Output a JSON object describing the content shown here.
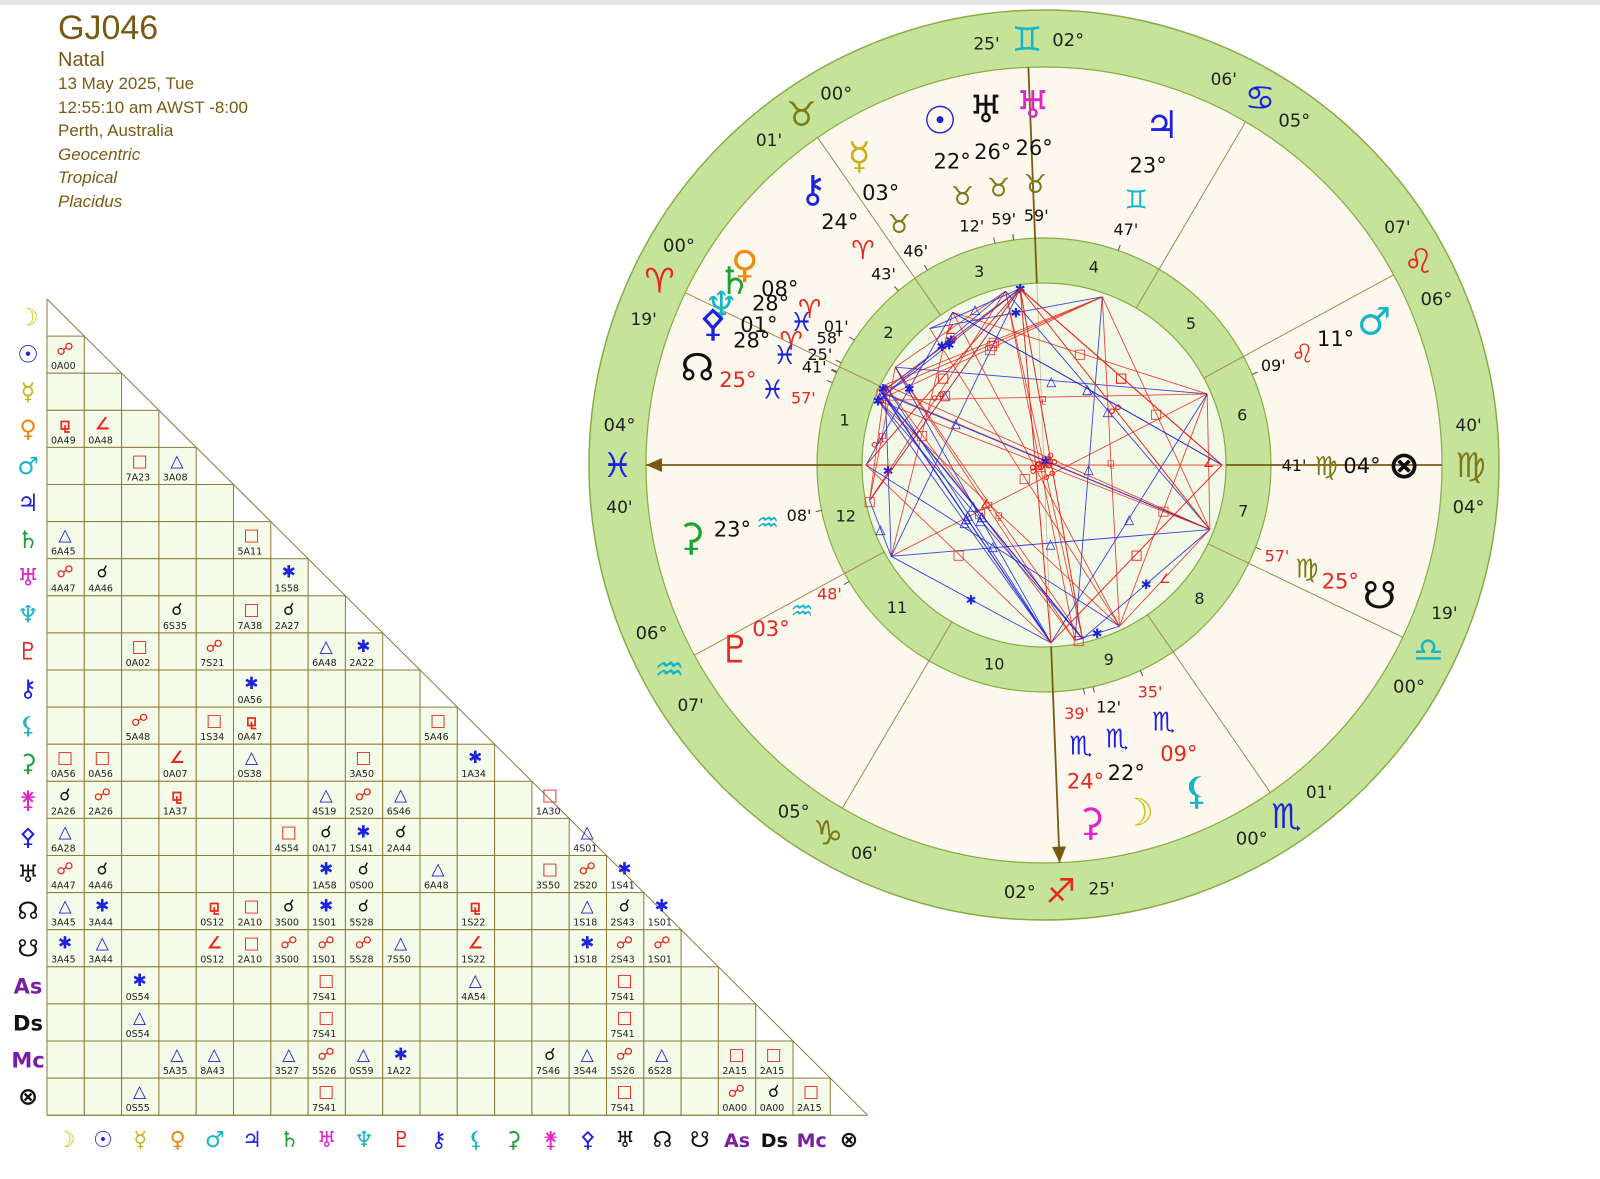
{
  "chart_info": {
    "name": "GJ046",
    "chart_type": "Natal",
    "date": "13 May 2025, Tue",
    "time": "12:55:10 am AWST -8:00",
    "place": "Perth, Australia",
    "zodiac_center": "Geocentric",
    "zodiac_type": "Tropical",
    "house_system": "Placidus"
  },
  "colors": {
    "wheel_ring": "#c5e49a",
    "wheel_ring_stroke": "#8aaa45",
    "chart_fill": "#fdf8ee",
    "inner_fill": "#f2f9e6",
    "grid_fill": "#f4fbe8",
    "grid_stroke": "#8b7a3a",
    "red": "#e8271e",
    "blue": "#1c22dd",
    "black": "#111111",
    "brown": "#7a5a12"
  },
  "grid_bodies": [
    {
      "glyph": "☽",
      "name": "Moon",
      "color": "#cfc217"
    },
    {
      "glyph": "☉",
      "name": "Sun",
      "color": "#1c22dd"
    },
    {
      "glyph": "☿",
      "name": "Mercury",
      "color": "#c9b11a"
    },
    {
      "glyph": "♀",
      "name": "Venus",
      "color": "#ee8a12"
    },
    {
      "glyph": "♂",
      "name": "Mars",
      "color": "#18b4c8"
    },
    {
      "glyph": "♃",
      "name": "Jupiter",
      "color": "#1c22dd"
    },
    {
      "glyph": "♄",
      "name": "Saturn",
      "color": "#1aa334"
    },
    {
      "glyph": "♅",
      "name": "Uranus",
      "color": "#e223c9"
    },
    {
      "glyph": "♆",
      "name": "Neptune",
      "color": "#18b4c8"
    },
    {
      "glyph": "♇",
      "name": "Pluto",
      "color": "#e8271e"
    },
    {
      "glyph": "⚷",
      "name": "Chiron",
      "color": "#1c22dd"
    },
    {
      "glyph": "⚸",
      "name": "Lilith",
      "color": "#18b4c8"
    },
    {
      "glyph": "⚳",
      "name": "Ceres",
      "color": "#1aa334"
    },
    {
      "glyph": "⚵",
      "name": "Juno",
      "color": "#e223c9"
    },
    {
      "glyph": "⚴",
      "name": "Pallas",
      "color": "#1c22dd"
    },
    {
      "glyph": "♅",
      "name": "Vertex",
      "color": "#111111"
    },
    {
      "glyph": "☊",
      "name": "North Node",
      "color": "#111111"
    },
    {
      "glyph": "☋",
      "name": "South Node",
      "color": "#111111"
    },
    {
      "glyph": "As",
      "name": "Ascendant",
      "color": "#7b1fa2"
    },
    {
      "glyph": "Ds",
      "name": "Descendant",
      "color": "#111111"
    },
    {
      "glyph": "Mc",
      "name": "Midheaven",
      "color": "#7b1fa2"
    },
    {
      "glyph": "⊗",
      "name": "Part of Fortune",
      "color": "#111111"
    }
  ],
  "aspects": [
    {
      "r": 1,
      "c": 0,
      "g": "☍",
      "t": "0A00",
      "k": "red"
    },
    {
      "r": 3,
      "c": 0,
      "g": "⚼",
      "t": "0A49",
      "k": "red"
    },
    {
      "r": 3,
      "c": 1,
      "g": "∠",
      "t": "0A48",
      "k": "red"
    },
    {
      "r": 4,
      "c": 2,
      "g": "□",
      "t": "7A23",
      "k": "red"
    },
    {
      "r": 4,
      "c": 3,
      "g": "△",
      "t": "3A08",
      "k": "blue"
    },
    {
      "r": 6,
      "c": 0,
      "g": "△",
      "t": "6A45",
      "k": "blue"
    },
    {
      "r": 6,
      "c": 5,
      "g": "□",
      "t": "5A11",
      "k": "red"
    },
    {
      "r": 7,
      "c": 0,
      "g": "☍",
      "t": "4A47",
      "k": "red"
    },
    {
      "r": 7,
      "c": 1,
      "g": "☌",
      "t": "4A46",
      "k": "black"
    },
    {
      "r": 7,
      "c": 6,
      "g": "✱",
      "t": "1S58",
      "k": "blue"
    },
    {
      "r": 8,
      "c": 3,
      "g": "☌",
      "t": "6S35",
      "k": "black"
    },
    {
      "r": 8,
      "c": 5,
      "g": "□",
      "t": "7A38",
      "k": "red"
    },
    {
      "r": 8,
      "c": 6,
      "g": "☌",
      "t": "2A27",
      "k": "black"
    },
    {
      "r": 9,
      "c": 2,
      "g": "□",
      "t": "0A02",
      "k": "red"
    },
    {
      "r": 9,
      "c": 4,
      "g": "☍",
      "t": "7S21",
      "k": "red"
    },
    {
      "r": 9,
      "c": 7,
      "g": "△",
      "t": "6A48",
      "k": "blue"
    },
    {
      "r": 9,
      "c": 8,
      "g": "✱",
      "t": "2A22",
      "k": "blue"
    },
    {
      "r": 10,
      "c": 5,
      "g": "✱",
      "t": "0A56",
      "k": "blue"
    },
    {
      "r": 11,
      "c": 2,
      "g": "☍",
      "t": "5A48",
      "k": "red"
    },
    {
      "r": 11,
      "c": 4,
      "g": "□",
      "t": "1S34",
      "k": "red"
    },
    {
      "r": 11,
      "c": 5,
      "g": "⚼",
      "t": "0A47",
      "k": "red"
    },
    {
      "r": 11,
      "c": 10,
      "g": "□",
      "t": "5A46",
      "k": "red"
    },
    {
      "r": 12,
      "c": 0,
      "g": "□",
      "t": "0A56",
      "k": "red"
    },
    {
      "r": 12,
      "c": 1,
      "g": "□",
      "t": "0A56",
      "k": "red"
    },
    {
      "r": 12,
      "c": 3,
      "g": "∠",
      "t": "0A07",
      "k": "red"
    },
    {
      "r": 12,
      "c": 5,
      "g": "△",
      "t": "0S38",
      "k": "blue"
    },
    {
      "r": 12,
      "c": 8,
      "g": "□",
      "t": "3A50",
      "k": "red"
    },
    {
      "r": 12,
      "c": 11,
      "g": "✱",
      "t": "1A34",
      "k": "blue"
    },
    {
      "r": 13,
      "c": 0,
      "g": "☌",
      "t": "2A26",
      "k": "black"
    },
    {
      "r": 13,
      "c": 1,
      "g": "☍",
      "t": "2A26",
      "k": "red"
    },
    {
      "r": 13,
      "c": 3,
      "g": "⚼",
      "t": "1A37",
      "k": "red"
    },
    {
      "r": 13,
      "c": 7,
      "g": "△",
      "t": "4S19",
      "k": "blue"
    },
    {
      "r": 13,
      "c": 8,
      "g": "☍",
      "t": "2S20",
      "k": "red"
    },
    {
      "r": 13,
      "c": 9,
      "g": "△",
      "t": "6S46",
      "k": "blue"
    },
    {
      "r": 13,
      "c": 13,
      "g": "□",
      "t": "1A30",
      "k": "red"
    },
    {
      "r": 14,
      "c": 0,
      "g": "△",
      "t": "6A28",
      "k": "blue"
    },
    {
      "r": 14,
      "c": 6,
      "g": "□",
      "t": "4S54",
      "k": "red"
    },
    {
      "r": 14,
      "c": 7,
      "g": "☌",
      "t": "0A17",
      "k": "black"
    },
    {
      "r": 14,
      "c": 8,
      "g": "✱",
      "t": "1S41",
      "k": "blue"
    },
    {
      "r": 14,
      "c": 9,
      "g": "☌",
      "t": "2A44",
      "k": "black"
    },
    {
      "r": 14,
      "c": 14,
      "g": "△",
      "t": "4S01",
      "k": "blue"
    },
    {
      "r": 15,
      "c": 0,
      "g": "☍",
      "t": "4A47",
      "k": "red"
    },
    {
      "r": 15,
      "c": 1,
      "g": "☌",
      "t": "4A46",
      "k": "black"
    },
    {
      "r": 15,
      "c": 7,
      "g": "✱",
      "t": "1A58",
      "k": "blue"
    },
    {
      "r": 15,
      "c": 8,
      "g": "☌",
      "t": "0S00",
      "k": "black"
    },
    {
      "r": 15,
      "c": 10,
      "g": "△",
      "t": "6A48",
      "k": "blue"
    },
    {
      "r": 15,
      "c": 13,
      "g": "□",
      "t": "3S50",
      "k": "red"
    },
    {
      "r": 15,
      "c": 14,
      "g": "☍",
      "t": "2S20",
      "k": "red"
    },
    {
      "r": 15,
      "c": 15,
      "g": "✱",
      "t": "1S41",
      "k": "blue"
    },
    {
      "r": 16,
      "c": 0,
      "g": "△",
      "t": "3A45",
      "k": "blue"
    },
    {
      "r": 16,
      "c": 1,
      "g": "✱",
      "t": "3A44",
      "k": "blue"
    },
    {
      "r": 16,
      "c": 4,
      "g": "⚼",
      "t": "0S12",
      "k": "red"
    },
    {
      "r": 16,
      "c": 5,
      "g": "□",
      "t": "2A10",
      "k": "red"
    },
    {
      "r": 16,
      "c": 6,
      "g": "☌",
      "t": "3S00",
      "k": "black"
    },
    {
      "r": 16,
      "c": 7,
      "g": "✱",
      "t": "1S01",
      "k": "blue"
    },
    {
      "r": 16,
      "c": 8,
      "g": "☌",
      "t": "5S28",
      "k": "black"
    },
    {
      "r": 16,
      "c": 11,
      "g": "⚼",
      "t": "1S22",
      "k": "red"
    },
    {
      "r": 16,
      "c": 14,
      "g": "△",
      "t": "1S18",
      "k": "blue"
    },
    {
      "r": 16,
      "c": 15,
      "g": "☌",
      "t": "2S43",
      "k": "black"
    },
    {
      "r": 16,
      "c": 16,
      "g": "✱",
      "t": "1S01",
      "k": "blue"
    },
    {
      "r": 17,
      "c": 0,
      "g": "✱",
      "t": "3A45",
      "k": "blue"
    },
    {
      "r": 17,
      "c": 1,
      "g": "△",
      "t": "3A44",
      "k": "blue"
    },
    {
      "r": 17,
      "c": 4,
      "g": "∠",
      "t": "0S12",
      "k": "red"
    },
    {
      "r": 17,
      "c": 5,
      "g": "□",
      "t": "2A10",
      "k": "red"
    },
    {
      "r": 17,
      "c": 6,
      "g": "☍",
      "t": "3S00",
      "k": "red"
    },
    {
      "r": 17,
      "c": 7,
      "g": "☍",
      "t": "1S01",
      "k": "red"
    },
    {
      "r": 17,
      "c": 8,
      "g": "☍",
      "t": "5S28",
      "k": "red"
    },
    {
      "r": 17,
      "c": 9,
      "g": "△",
      "t": "7S50",
      "k": "blue"
    },
    {
      "r": 17,
      "c": 11,
      "g": "∠",
      "t": "1S22",
      "k": "red"
    },
    {
      "r": 17,
      "c": 14,
      "g": "✱",
      "t": "1S18",
      "k": "blue"
    },
    {
      "r": 17,
      "c": 15,
      "g": "☍",
      "t": "2S43",
      "k": "red"
    },
    {
      "r": 17,
      "c": 16,
      "g": "☍",
      "t": "1S01",
      "k": "red"
    },
    {
      "r": 18,
      "c": 2,
      "g": "✱",
      "t": "0S54",
      "k": "blue"
    },
    {
      "r": 18,
      "c": 7,
      "g": "□",
      "t": "7S41",
      "k": "red"
    },
    {
      "r": 18,
      "c": 11,
      "g": "△",
      "t": "4A54",
      "k": "blue"
    },
    {
      "r": 18,
      "c": 15,
      "g": "□",
      "t": "7S41",
      "k": "red"
    },
    {
      "r": 19,
      "c": 2,
      "g": "△",
      "t": "0S54",
      "k": "blue"
    },
    {
      "r": 19,
      "c": 7,
      "g": "□",
      "t": "7S41",
      "k": "red"
    },
    {
      "r": 19,
      "c": 15,
      "g": "□",
      "t": "7S41",
      "k": "red"
    },
    {
      "r": 20,
      "c": 3,
      "g": "△",
      "t": "5A35",
      "k": "blue"
    },
    {
      "r": 20,
      "c": 4,
      "g": "△",
      "t": "8A43",
      "k": "blue"
    },
    {
      "r": 20,
      "c": 6,
      "g": "△",
      "t": "3S27",
      "k": "blue"
    },
    {
      "r": 20,
      "c": 7,
      "g": "☍",
      "t": "5S26",
      "k": "red"
    },
    {
      "r": 20,
      "c": 8,
      "g": "△",
      "t": "0S59",
      "k": "blue"
    },
    {
      "r": 20,
      "c": 9,
      "g": "✱",
      "t": "1A22",
      "k": "blue"
    },
    {
      "r": 20,
      "c": 13,
      "g": "☌",
      "t": "7S46",
      "k": "black"
    },
    {
      "r": 20,
      "c": 14,
      "g": "△",
      "t": "3S44",
      "k": "blue"
    },
    {
      "r": 20,
      "c": 15,
      "g": "☍",
      "t": "5S26",
      "k": "red"
    },
    {
      "r": 20,
      "c": 16,
      "g": "△",
      "t": "6S28",
      "k": "blue"
    },
    {
      "r": 20,
      "c": 18,
      "g": "□",
      "t": "2A15",
      "k": "red"
    },
    {
      "r": 20,
      "c": 19,
      "g": "□",
      "t": "2A15",
      "k": "red"
    },
    {
      "r": 21,
      "c": 2,
      "g": "△",
      "t": "0S55",
      "k": "blue"
    },
    {
      "r": 21,
      "c": 7,
      "g": "□",
      "t": "7S41",
      "k": "red"
    },
    {
      "r": 21,
      "c": 15,
      "g": "□",
      "t": "7S41",
      "k": "red"
    },
    {
      "r": 21,
      "c": 18,
      "g": "☍",
      "t": "0A00",
      "k": "red"
    },
    {
      "r": 21,
      "c": 19,
      "g": "☌",
      "t": "0A00",
      "k": "black"
    },
    {
      "r": 21,
      "c": 20,
      "g": "□",
      "t": "2A15",
      "k": "red"
    }
  ],
  "wheel": {
    "asc_longitude": 334.67,
    "cusps": [
      {
        "house": 1,
        "lon": 334.67
      },
      {
        "house": 2,
        "lon": 0.32
      },
      {
        "house": 3,
        "lon": 30.02
      },
      {
        "house": 4,
        "lon": 62.42
      },
      {
        "house": 5,
        "lon": 95.1
      },
      {
        "house": 6,
        "lon": 126.12
      },
      {
        "house": 7,
        "lon": 154.67
      },
      {
        "house": 8,
        "lon": 180.32
      },
      {
        "house": 9,
        "lon": 210.02
      },
      {
        "house": 10,
        "lon": 242.42
      },
      {
        "house": 11,
        "lon": 275.1
      },
      {
        "house": 12,
        "lon": 306.12
      }
    ],
    "cusp_labels": [
      {
        "house": 1,
        "deg": "04°",
        "min": "40'",
        "sign": "♓",
        "color": "#1c22dd"
      },
      {
        "house": 2,
        "deg": "00°",
        "min": "19'",
        "sign": "♈",
        "color": "#e8271e"
      },
      {
        "house": 3,
        "deg": "00°",
        "min": "01'",
        "sign": "♉",
        "color": "#7b7a16"
      },
      {
        "house": 4,
        "deg": "02°",
        "min": "25'",
        "sign": "♊",
        "color": "#18b4c8"
      },
      {
        "house": 5,
        "deg": "05°",
        "min": "06'",
        "sign": "♋",
        "color": "#1c22dd"
      },
      {
        "house": 6,
        "deg": "06°",
        "min": "07'",
        "sign": "♌",
        "color": "#e8271e"
      },
      {
        "house": 7,
        "deg": "04°",
        "min": "40'",
        "sign": "♍",
        "color": "#7b7a16"
      },
      {
        "house": 8,
        "deg": "00°",
        "min": "19'",
        "sign": "♎",
        "color": "#18b4c8"
      },
      {
        "house": 9,
        "deg": "00°",
        "min": "01'",
        "sign": "♏",
        "color": "#1c22dd"
      },
      {
        "house": 10,
        "deg": "02°",
        "min": "25'",
        "sign": "♐",
        "color": "#e8271e"
      },
      {
        "house": 11,
        "deg": "05°",
        "min": "06'",
        "sign": "♑",
        "color": "#7b7a16"
      },
      {
        "house": 12,
        "deg": "06°",
        "min": "07'",
        "sign": "♒",
        "color": "#18b4c8"
      }
    ],
    "planets": [
      {
        "name": "Moon",
        "glyph": "☽",
        "color": "#cfc217",
        "deg": "22°",
        "sign": "♏",
        "signColor": "#1c22dd",
        "min": "12'",
        "lon": 232.2,
        "degColor": "#111111"
      },
      {
        "name": "Ceres",
        "glyph": "⚳",
        "color": "#e223c9",
        "deg": "24°",
        "sign": "♏",
        "signColor": "#1c22dd",
        "min": "39'",
        "lon": 234.65,
        "degColor": "#e8271e"
      },
      {
        "name": "Lilith",
        "glyph": "⚸",
        "color": "#18b4c8",
        "deg": "09°",
        "sign": "♏",
        "signColor": "#1c22dd",
        "min": "35'",
        "lon": 219.58,
        "degColor": "#e8271e"
      },
      {
        "name": "South Node",
        "glyph": "☋",
        "color": "#111111",
        "deg": "25°",
        "sign": "♍",
        "signColor": "#7b7a16",
        "min": "57'",
        "lon": 175.95,
        "degColor": "#e8271e"
      },
      {
        "name": "Part of Fortune",
        "glyph": "⊗",
        "color": "#111111",
        "deg": "04°",
        "sign": "♍",
        "signColor": "#7b7a16",
        "min": "41'",
        "lon": 154.68,
        "degColor": "#111111"
      },
      {
        "name": "Mars",
        "glyph": "♂",
        "color": "#18b4c8",
        "deg": "11°",
        "sign": "♌",
        "signColor": "#e8271e",
        "min": "09'",
        "lon": 131.15,
        "degColor": "#111111"
      },
      {
        "name": "Jupiter",
        "glyph": "♃",
        "color": "#1c22dd",
        "deg": "23°",
        "sign": "♊",
        "signColor": "#18b4c8",
        "min": "47'",
        "lon": 83.78,
        "degColor": "#111111"
      },
      {
        "name": "Vertex",
        "glyph": "♅",
        "color": "#111111",
        "deg": "26°",
        "sign": "♉",
        "signColor": "#7b7a16",
        "min": "59'",
        "lon": 56.98,
        "degColor": "#111111"
      },
      {
        "name": "Uranus",
        "glyph": "♅",
        "color": "#e223c9",
        "deg": "26°",
        "sign": "♉",
        "signColor": "#7b7a16",
        "min": "59'",
        "lon": 56.98,
        "degColor": "#111111"
      },
      {
        "name": "Sun",
        "glyph": "☉",
        "color": "#1c22dd",
        "deg": "22°",
        "sign": "♉",
        "signColor": "#7b7a16",
        "min": "12'",
        "lon": 52.2,
        "degColor": "#111111"
      },
      {
        "name": "Mercury",
        "glyph": "☿",
        "color": "#c9b11a",
        "deg": "03°",
        "sign": "♉",
        "signColor": "#7b7a16",
        "min": "46'",
        "lon": 33.77,
        "degColor": "#111111"
      },
      {
        "name": "Chiron",
        "glyph": "⚷",
        "color": "#1c22dd",
        "deg": "24°",
        "sign": "♈",
        "signColor": "#e8271e",
        "min": "43'",
        "lon": 24.72,
        "degColor": "#111111"
      },
      {
        "name": "Venus",
        "glyph": "♀",
        "color": "#ee8a12",
        "deg": "08°",
        "sign": "♈",
        "signColor": "#e8271e",
        "min": "01'",
        "lon": 8.02,
        "degColor": "#111111"
      },
      {
        "name": "Neptune",
        "glyph": "♆",
        "color": "#18b4c8",
        "deg": "01°",
        "sign": "♈",
        "signColor": "#e8271e",
        "min": "25'",
        "lon": 1.42,
        "degColor": "#111111"
      },
      {
        "name": "Saturn",
        "glyph": "♄",
        "color": "#1aa334",
        "deg": "28°",
        "sign": "♓",
        "signColor": "#1c22dd",
        "min": "58'",
        "lon": 358.97,
        "degColor": "#111111"
      },
      {
        "name": "Pallas",
        "glyph": "⚴",
        "color": "#1c22dd",
        "deg": "28°",
        "sign": "♓",
        "signColor": "#1c22dd",
        "min": "41'",
        "lon": 358.68,
        "degColor": "#111111"
      },
      {
        "name": "North Node",
        "glyph": "☊",
        "color": "#111111",
        "deg": "25°",
        "sign": "♓",
        "signColor": "#1c22dd",
        "min": "57'",
        "lon": 355.95,
        "degColor": "#e8271e"
      },
      {
        "name": "Juno",
        "glyph": "⚳",
        "color": "#1aa334",
        "deg": "23°",
        "sign": "♒",
        "signColor": "#18b4c8",
        "min": "08'",
        "lon": 323.13,
        "degColor": "#111111"
      },
      {
        "name": "Pluto",
        "glyph": "♇",
        "color": "#e8271e",
        "deg": "03°",
        "sign": "♒",
        "signColor": "#18b4c8",
        "min": "48'",
        "lon": 303.8,
        "degColor": "#e8271e"
      }
    ]
  }
}
